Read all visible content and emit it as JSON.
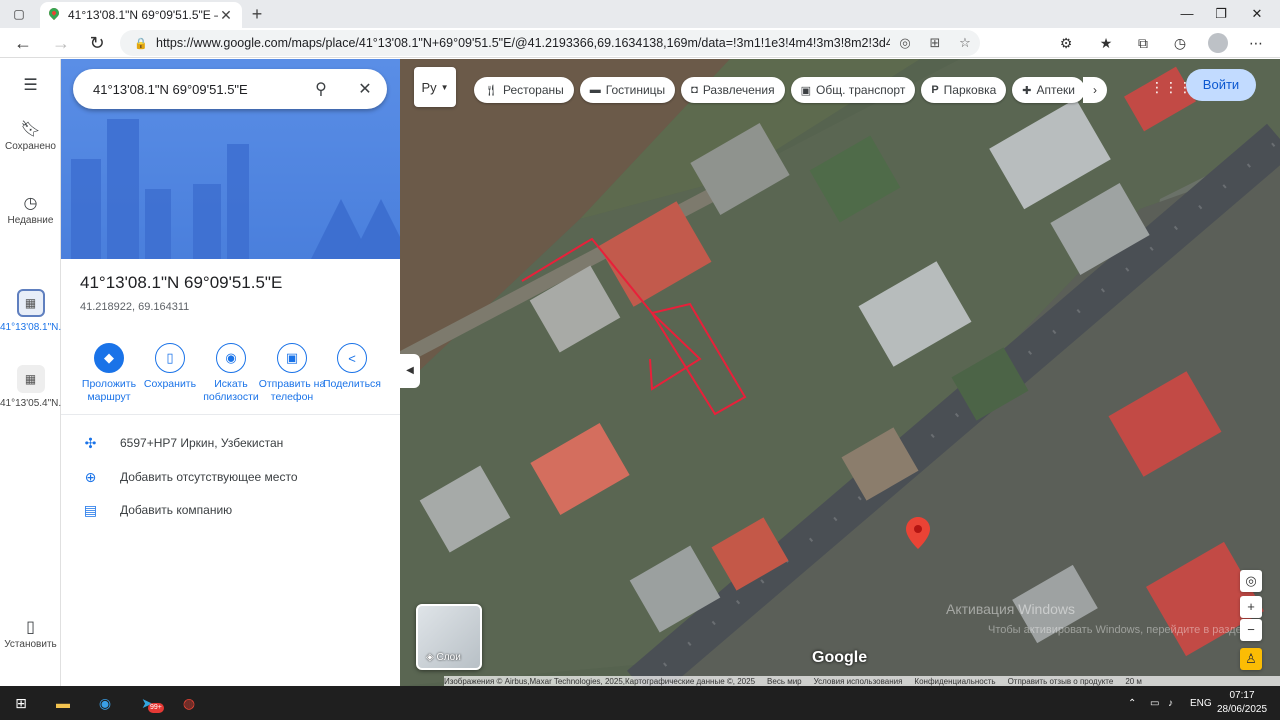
{
  "browser": {
    "tab_title": "41°13'08.1\"N 69°09'51.5\"E – Goo",
    "url": "https://www.google.com/maps/place/41°13'08.1\"N+69°09'51.5\"E/@41.2193366,69.1634138,169m/data=!3m1!1e3!4m4!3m3!8m2!3d41.218922!4d69.16..."
  },
  "rail": {
    "saved": "Сохранено",
    "recent": "Недавние",
    "history1": "41°13'08.1\"N...",
    "history2": "41°13'05.4\"N...",
    "install": "Установить"
  },
  "panel": {
    "search_value": "41°13'08.1\"N 69°09'51.5\"E",
    "title": "41°13'08.1\"N 69°09'51.5\"E",
    "coords": "41.218922, 69.164311",
    "actions": [
      {
        "label": "Проложить маршрут",
        "icon": "directions-icon"
      },
      {
        "label": "Сохранить",
        "icon": "bookmark-icon"
      },
      {
        "label": "Искать поблизости",
        "icon": "nearby-icon"
      },
      {
        "label": "Отправить на телефон",
        "icon": "phone-icon"
      },
      {
        "label": "Поделиться",
        "icon": "share-icon"
      }
    ],
    "info": [
      {
        "text": "6597+HP7 Иркин, Узбекистан",
        "icon": "plus-code-icon"
      },
      {
        "text": "Добавить отсутствующее место",
        "icon": "add-place-icon"
      },
      {
        "text": "Добавить компанию",
        "icon": "add-business-icon"
      }
    ]
  },
  "map": {
    "layer_type": "Ру",
    "chips": [
      {
        "label": "Рестораны",
        "icon": "restaurant-icon"
      },
      {
        "label": "Гостиницы",
        "icon": "hotel-icon"
      },
      {
        "label": "Развлечения",
        "icon": "camera-icon"
      },
      {
        "label": "Общ. транспорт",
        "icon": "transit-icon"
      },
      {
        "label": "Парковка",
        "icon": "parking-icon"
      },
      {
        "label": "Аптеки",
        "icon": "pharmacy-icon"
      }
    ],
    "signin": "Войти",
    "layers": "Слои",
    "logo": "Google",
    "watermark": "Активация Windows",
    "watermark_sub": "Чтобы активировать Windows, перейдите в раздел",
    "attribution": [
      "Изображения © Airbus,Maxar Technologies, 2025,Картографические данные ©, 2025",
      "Весь мир",
      "Условия использования",
      "Конфиденциальность",
      "Отправить отзыв о продукте",
      "20 м"
    ]
  },
  "taskbar": {
    "lang": "ENG",
    "time": "07:17",
    "date": "28/06/2025",
    "badge": "99+"
  }
}
